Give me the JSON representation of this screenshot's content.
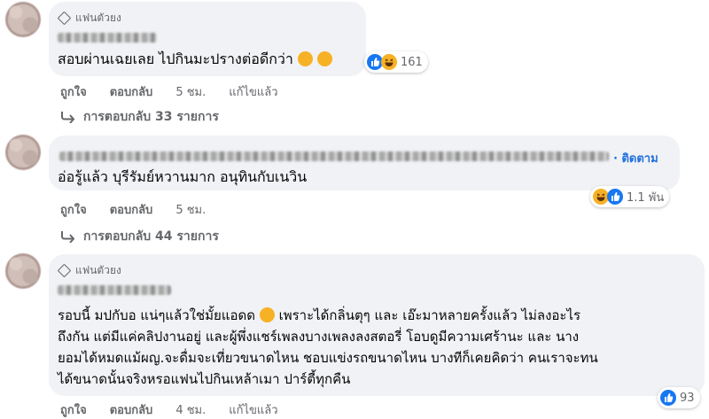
{
  "comments": [
    {
      "badge": "แฟนตัวยง",
      "text": "สอบผ่านเฉยเลย ไปกินมะปรางต่อดีกว่า",
      "actions": {
        "like": "ถูกใจ",
        "reply": "ตอบกลับ",
        "time": "5 ชม.",
        "edited": "แก้ไขแล้ว"
      },
      "reaction_count": "161",
      "replies_label": "การตอบกลับ 33 รายการ"
    },
    {
      "follow": "· ติดตาม",
      "text": "อ่อรู้แล้ว บุรีรัมย์หวานมาก อนุทินกับเนวิน",
      "actions": {
        "like": "ถูกใจ",
        "reply": "ตอบกลับ",
        "time": "5 ชม."
      },
      "reaction_count": "1.1 พัน",
      "replies_label": "การตอบกลับ 44 รายการ"
    },
    {
      "badge": "แฟนตัวยง",
      "lines": [
        "รอบนี้ มปกับอ แน่ๆแล้วใช่มั้ยแอดด",
        "เพราะได้กลิ่นตุๆ และ เอ๊ะมาหลายครั้งแล้ว ไม่ลงอะไร",
        "ถึงกัน แต่มีแค่คลิปงานอยู่ และผู้พึ่งแชร์เพลงบางเพลงลงสตอรี่ โอบดูมีความเศร้านะ และ นาง",
        "ยอมได้หมดแม้ผญ.จะดื่มจะเที่ยวขนาดไหน ชอบแข่งรถขนาดไหน บางทีก็เคยคิดว่า คนเราจะทน",
        "ได้ขนาดนั้นจริงหรอแฟนไปกินเหล้าเมา ปาร์ตี้ทุกคืน"
      ],
      "actions": {
        "like": "ถูกใจ",
        "reply": "ตอบกลับ",
        "time": "4 ชม.",
        "edited": "แก้ไขแล้ว"
      },
      "reaction_count": "93"
    }
  ],
  "colors": {
    "bubble": "#f0f2f5",
    "link": "#216fdb",
    "muted": "#65676b",
    "like": "#1877f2",
    "haha": "#f7b125"
  },
  "icons": [
    "diamond-icon",
    "reply-arrow-icon",
    "like-reaction-icon",
    "haha-reaction-icon"
  ]
}
